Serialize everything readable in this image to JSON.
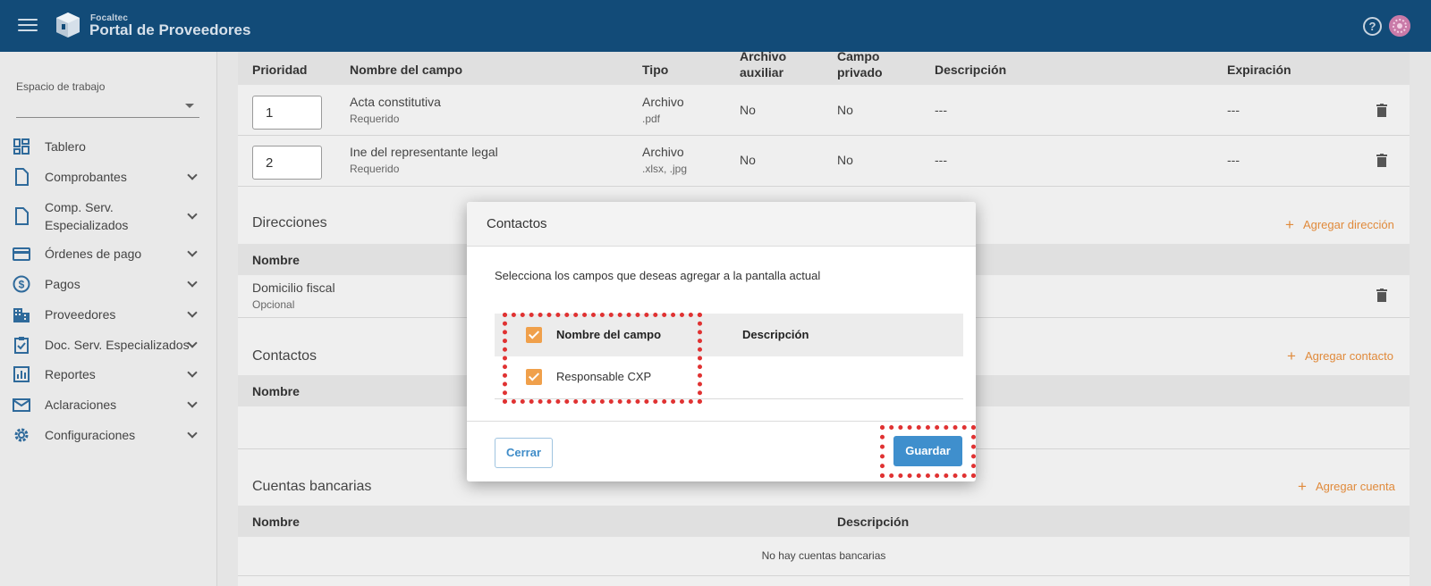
{
  "header": {
    "brand_small": "Focaltec",
    "brand_title": "Portal de Proveedores"
  },
  "sidebar": {
    "workspace_label": "Espacio de trabajo",
    "items": [
      {
        "label": "Tablero",
        "has_chevron": false
      },
      {
        "label": "Comprobantes",
        "has_chevron": true
      },
      {
        "label": "Comp. Serv.",
        "label2": "Especializados",
        "has_chevron": true
      },
      {
        "label": "Órdenes de pago",
        "has_chevron": true
      },
      {
        "label": "Pagos",
        "has_chevron": true
      },
      {
        "label": "Proveedores",
        "has_chevron": true
      },
      {
        "label": "Doc. Serv. Especializados",
        "has_chevron": true
      },
      {
        "label": "Reportes",
        "has_chevron": true
      },
      {
        "label": "Aclaraciones",
        "has_chevron": true
      },
      {
        "label": "Configuraciones",
        "has_chevron": true
      }
    ]
  },
  "documents_table": {
    "headers": {
      "prioridad": "Prioridad",
      "nombre": "Nombre del campo",
      "tipo": "Tipo",
      "archivo_aux_1": "Archivo",
      "archivo_aux_2": "auxiliar",
      "campo_priv_1": "Campo",
      "campo_priv_2": "privado",
      "descripcion": "Descripción",
      "expiracion": "Expiración"
    },
    "rows": [
      {
        "priority": "1",
        "name": "Acta constitutiva",
        "required": "Requerido",
        "type": "Archivo",
        "ext": ".pdf",
        "aux": "No",
        "private": "No",
        "desc": "---",
        "exp": "---"
      },
      {
        "priority": "2",
        "name": "Ine del representante legal",
        "required": "Requerido",
        "type": "Archivo",
        "ext": ".xlsx, .jpg",
        "aux": "No",
        "private": "No",
        "desc": "---",
        "exp": "---"
      }
    ]
  },
  "addresses": {
    "title": "Direcciones",
    "add_label": "Agregar dirección",
    "col_name": "Nombre",
    "rows": [
      {
        "name": "Domicilio fiscal",
        "status": "Opcional"
      }
    ]
  },
  "contacts": {
    "title": "Contactos",
    "add_label": "Agregar contacto",
    "col_name": "Nombre"
  },
  "bank_accounts": {
    "title": "Cuentas bancarias",
    "add_label": "Agregar cuenta",
    "col_name": "Nombre",
    "col_desc": "Descripción",
    "empty": "No hay cuentas bancarias"
  },
  "modal": {
    "title": "Contactos",
    "description": "Selecciona los campos que deseas agregar a la pantalla actual",
    "col_name": "Nombre del campo",
    "col_desc": "Descripción",
    "rows": [
      {
        "name": "Responsable CXP",
        "checked": true
      }
    ],
    "header_checked": true,
    "close_label": "Cerrar",
    "save_label": "Guardar"
  },
  "colors": {
    "topbar": "#124b78",
    "accent_orange": "#e08a3b",
    "primary_blue": "#3f8fcd",
    "highlight": "#e03232"
  }
}
